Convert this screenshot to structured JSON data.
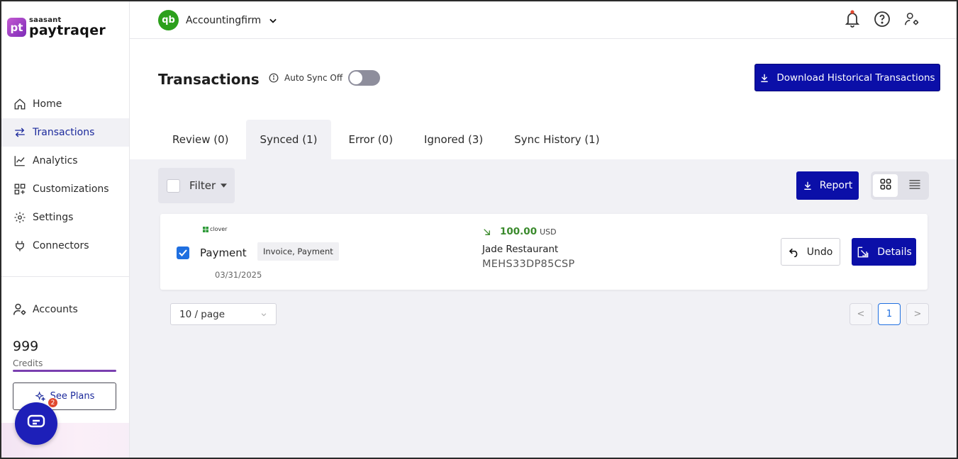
{
  "brand": {
    "small": "saasant",
    "big": "paytraqer",
    "mark": "pt"
  },
  "sidebar": {
    "items": [
      {
        "label": "Home",
        "icon": "home-icon"
      },
      {
        "label": "Transactions",
        "icon": "arrows-icon"
      },
      {
        "label": "Analytics",
        "icon": "chart-icon"
      },
      {
        "label": "Customizations",
        "icon": "grid-icon"
      },
      {
        "label": "Settings",
        "icon": "gear-icon"
      },
      {
        "label": "Connectors",
        "icon": "plug-icon"
      }
    ],
    "active": "Transactions",
    "accounts_label": "Accounts",
    "credits_value": "999",
    "credits_label": "Credits",
    "see_plans_label": "See Plans",
    "chat_badge": "2"
  },
  "topbar": {
    "company_logo": "qb",
    "company_name": "Accountingfirm"
  },
  "page": {
    "title": "Transactions",
    "auto_sync_label": "Auto Sync Off",
    "download_label": "Download Historical Transactions"
  },
  "tabs": [
    {
      "label": "Review (0)"
    },
    {
      "label": "Synced (1)"
    },
    {
      "label": "Error (0)"
    },
    {
      "label": "Ignored (3)"
    },
    {
      "label": "Sync History (1)"
    }
  ],
  "active_tab": "Synced (1)",
  "toolbar": {
    "filter_label": "Filter",
    "report_label": "Report"
  },
  "transaction": {
    "source": "clover",
    "type": "Payment",
    "tag": "Invoice, Payment",
    "date": "03/31/2025",
    "amount": "100.00",
    "currency": "USD",
    "merchant": "Jade Restaurant",
    "reference": "MEHS33DP85CSP",
    "undo_label": "Undo",
    "details_label": "Details"
  },
  "pagination": {
    "page_size": "10 / page",
    "current_page": "1",
    "prev": "<",
    "next": ">"
  },
  "colors": {
    "primary": "#0b0fa8",
    "accent_green": "#3a8a2c",
    "qb_green": "#2ca01c",
    "brand_purple": "#7d2bb8"
  }
}
